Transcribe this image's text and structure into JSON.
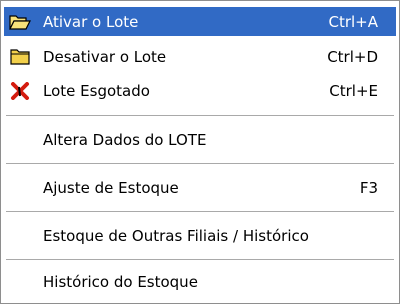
{
  "menu": {
    "items": [
      {
        "label": "Ativar o Lote",
        "shortcut": "Ctrl+A",
        "icon": "folder-open-icon",
        "selected": true
      },
      {
        "label": "Desativar o Lote",
        "shortcut": "Ctrl+D",
        "icon": "folder-closed-icon"
      },
      {
        "label": "Lote Esgotado",
        "shortcut": "Ctrl+E",
        "icon": "red-x-icon"
      },
      {
        "label": "Altera Dados do LOTE",
        "shortcut": ""
      },
      {
        "label": "Ajuste de Estoque",
        "shortcut": "F3"
      },
      {
        "label": "Estoque de Outras Filiais / Histórico",
        "shortcut": ""
      },
      {
        "label": "Histórico do Estoque",
        "shortcut": ""
      }
    ]
  },
  "colors": {
    "selection": "#316ac5",
    "folder": "#f2d04b",
    "x_mark": "#d41c0f"
  }
}
